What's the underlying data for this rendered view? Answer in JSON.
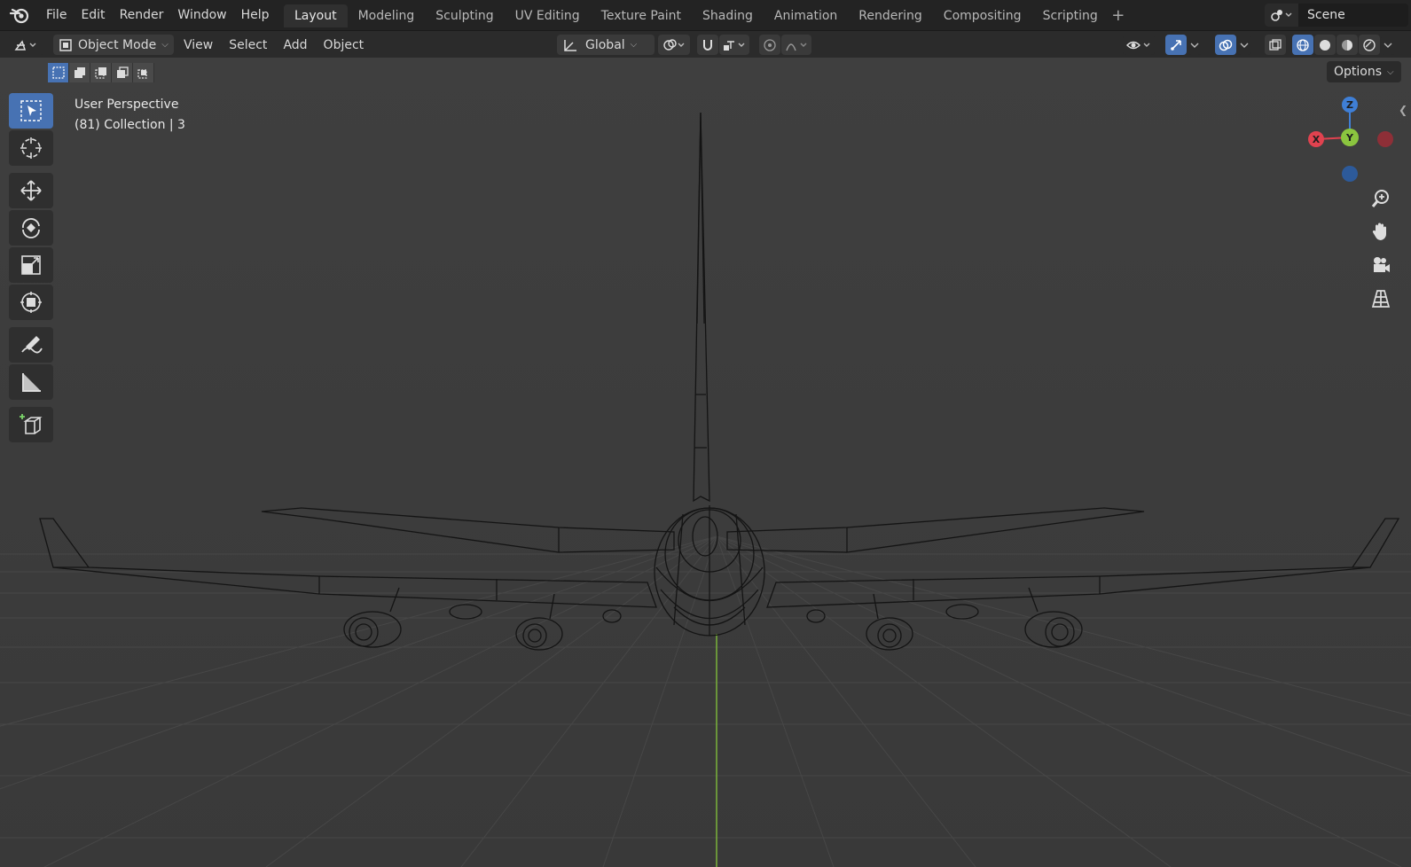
{
  "menubar": {
    "items": [
      "File",
      "Edit",
      "Render",
      "Window",
      "Help"
    ]
  },
  "workspaces": {
    "tabs": [
      "Layout",
      "Modeling",
      "Sculpting",
      "UV Editing",
      "Texture Paint",
      "Shading",
      "Animation",
      "Rendering",
      "Compositing",
      "Scripting"
    ],
    "active": "Layout",
    "add_label": "+"
  },
  "scene": {
    "name": "Scene"
  },
  "header": {
    "mode": "Object Mode",
    "menus": [
      "View",
      "Select",
      "Add",
      "Object"
    ],
    "orientation": "Global"
  },
  "viewport": {
    "view_name": "User Perspective",
    "collection_info": "(81) Collection | 3",
    "options_label": "Options"
  },
  "gizmo": {
    "z": "Z",
    "y": "Y",
    "x": "X"
  },
  "tools": [
    "select-box-icon",
    "cursor-icon",
    "move-icon",
    "rotate-icon",
    "scale-icon",
    "transform-icon",
    "annotate-icon",
    "measure-icon",
    "add-cube-icon"
  ],
  "colors": {
    "accent": "#4772b3",
    "x_axis": "#e0424f",
    "y_axis": "#8bc53f",
    "z_axis": "#3f7fd6",
    "background": "#3d3d3d"
  }
}
